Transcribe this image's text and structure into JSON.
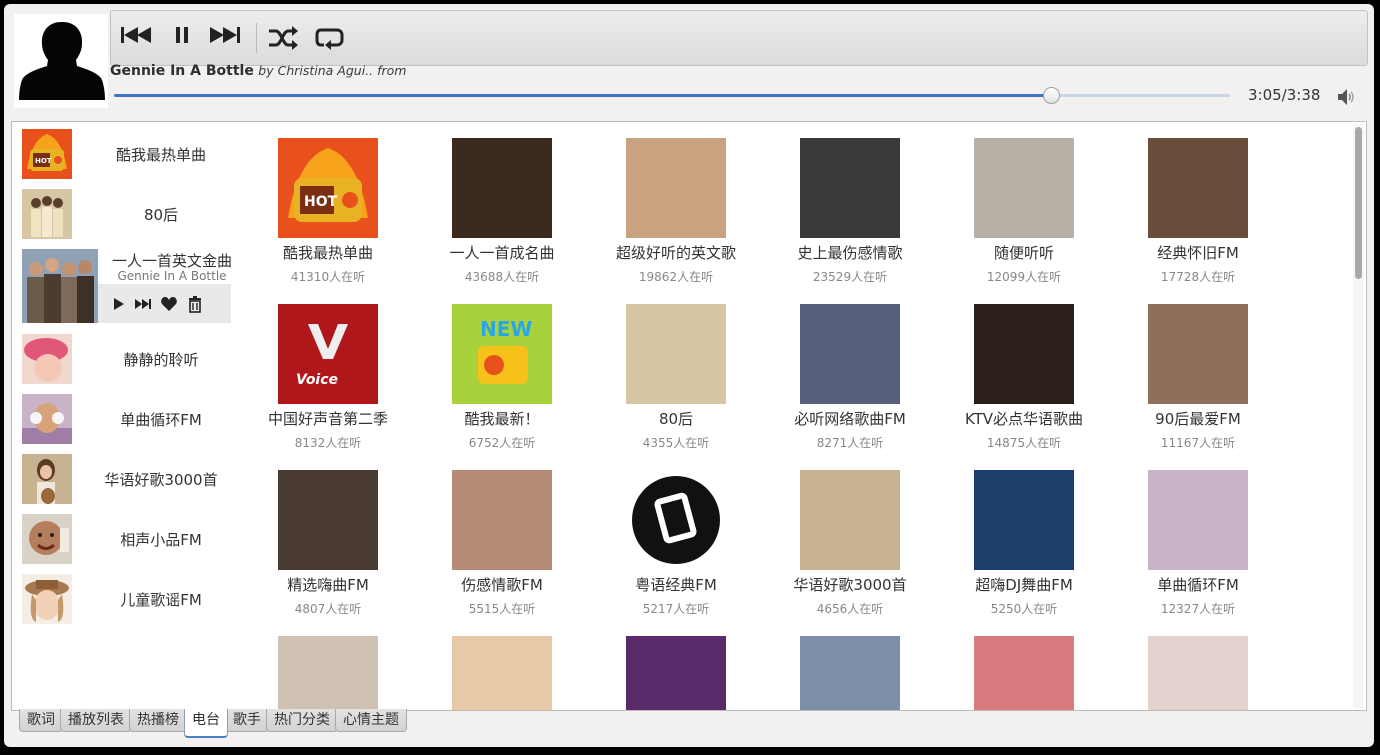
{
  "player": {
    "song_title": "Gennie In A Bottle",
    "song_meta": "by Christina Agui.. from",
    "time": "3:05/3:38",
    "progress": 0.84,
    "controls": [
      "previous-icon",
      "pause-icon",
      "next-icon",
      "shuffle-icon",
      "repeat-icon"
    ],
    "accent_color": "#3f74c2"
  },
  "recent": [
    {
      "name": "酷我最热单曲",
      "icon": "hot-radio-icon"
    },
    {
      "name": "80后",
      "icon": "group-photo"
    },
    {
      "name": "一人一首英文金曲",
      "sub": "Gennie In A Bottle",
      "icon": "band-photo",
      "active": true
    },
    {
      "name": "静静的聆听",
      "icon": "girl-pink-hat-photo"
    },
    {
      "name": "单曲循环FM",
      "icon": "girl-headphones-photo"
    },
    {
      "name": "华语好歌3000首",
      "icon": "girl-guitar-photo"
    },
    {
      "name": "相声小品FM",
      "icon": "comedian-photo"
    },
    {
      "name": "儿童歌谣FM",
      "icon": "girl-hat-photo"
    }
  ],
  "stations": [
    {
      "name": "酷我最热单曲",
      "count": "41310人在听",
      "bg": "#e8501c"
    },
    {
      "name": "一人一首成名曲",
      "count": "43688人在听",
      "bg": "#3b2a1d"
    },
    {
      "name": "超级好听的英文歌",
      "count": "19862人在听",
      "bg": "#c9a37f"
    },
    {
      "name": "史上最伤感情歌",
      "count": "23529人在听",
      "bg": "#3a3a3a"
    },
    {
      "name": "随便听听",
      "count": "12099人在听",
      "bg": "#b7b0a6"
    },
    {
      "name": "经典怀旧FM",
      "count": "17728人在听",
      "bg": "#6b4d3b"
    },
    {
      "name": "中国好声音第二季",
      "count": "8132人在听",
      "bg": "#b0171a"
    },
    {
      "name": "酷我最新！",
      "count": "6752人在听",
      "bg": "#a9d13b"
    },
    {
      "name": "80后",
      "count": "4355人在听",
      "bg": "#d6c6a3"
    },
    {
      "name": "必听网络歌曲FM",
      "count": "8271人在听",
      "bg": "#56607a"
    },
    {
      "name": "KTV必点华语歌曲",
      "count": "14875人在听",
      "bg": "#2b1f19"
    },
    {
      "name": "90后最爱FM",
      "count": "11167人在听",
      "bg": "#8f6e5c"
    },
    {
      "name": "精选嗨曲FM",
      "count": "4807人在听",
      "bg": "#4b3b35"
    },
    {
      "name": "伤感情歌FM",
      "count": "5515人在听",
      "bg": "#b58b78"
    },
    {
      "name": "粤语经典FM",
      "count": "5217人在听",
      "bg": "#ffffff"
    },
    {
      "name": "华语好歌3000首",
      "count": "4656人在听",
      "bg": "#c7b292"
    },
    {
      "name": "超嗨DJ舞曲FM",
      "count": "5250人在听",
      "bg": "#1c3e6b"
    },
    {
      "name": "单曲循环FM",
      "count": "12327人在听",
      "bg": "#c8b3c7"
    },
    {
      "name": "",
      "count": "",
      "bg": "#cfc2b5"
    },
    {
      "name": "",
      "count": "",
      "bg": "#e8c9a7"
    },
    {
      "name": "",
      "count": "",
      "bg": "#5a2a6b"
    },
    {
      "name": "",
      "count": "",
      "bg": "#7d8fa8"
    },
    {
      "name": "",
      "count": "",
      "bg": "#d97b7e"
    },
    {
      "name": "",
      "count": "",
      "bg": "#e2d3ce"
    }
  ],
  "tabs": [
    {
      "label": "歌词"
    },
    {
      "label": "播放列表"
    },
    {
      "label": "热播榜"
    },
    {
      "label": "电台",
      "active": true
    },
    {
      "label": "歌手"
    },
    {
      "label": "热门分类"
    },
    {
      "label": "心情主题"
    }
  ]
}
